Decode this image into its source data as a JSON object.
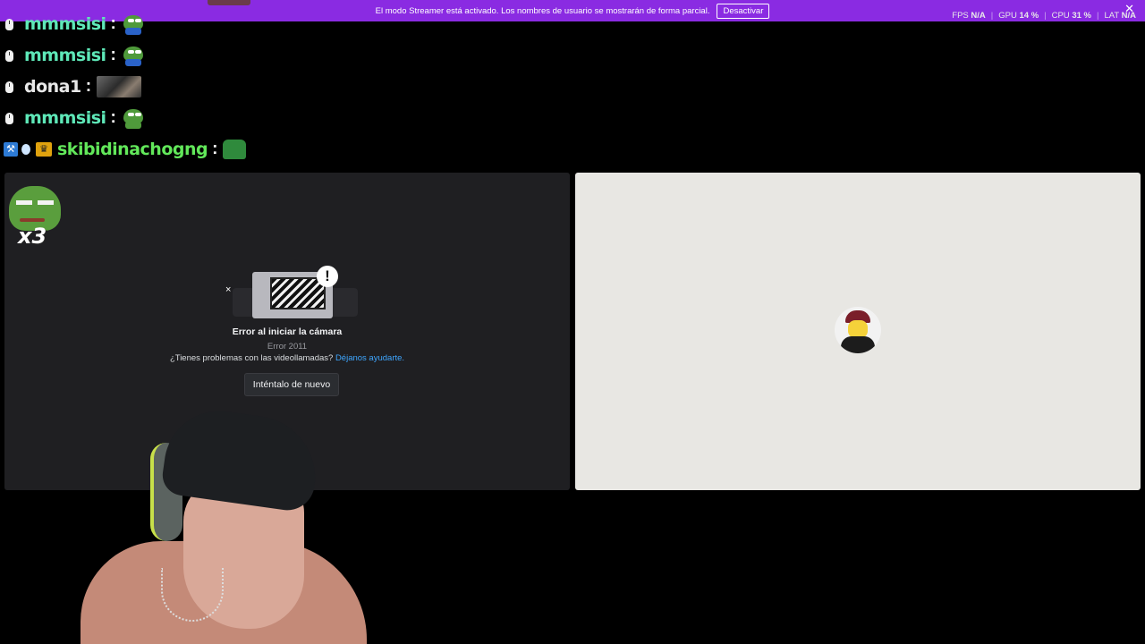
{
  "banner": {
    "message": "El modo Streamer está activado. Los nombres de usuario se mostrarán de forma parcial.",
    "button_label": "Desactivar",
    "close_glyph": "✕",
    "color": "#8a2be2"
  },
  "stats": {
    "fps_label": "FPS",
    "fps_value": "N/A",
    "gpu_label": "GPU",
    "gpu_value": "14 %",
    "cpu_label": "CPU",
    "cpu_value": "31 %",
    "lat_label": "LAT",
    "lat_value": "N/A"
  },
  "chat": [
    {
      "username": "mmmsisi",
      "color": "#5ee8b8",
      "emote": "pepe-icon"
    },
    {
      "username": "mmmsisi",
      "color": "#5ee8b8",
      "emote": "pepe-icon"
    },
    {
      "username": "dona1",
      "color": "#e8e8e8",
      "emote": "photo-emote"
    },
    {
      "username": "mmmsisi",
      "color": "#5ee8b8",
      "emote": "pepe-icon"
    },
    {
      "username": "skibidinachogng",
      "color": "#62e85a",
      "emote": "green-emote",
      "badges": [
        "hammer-badge-icon",
        "drop-badge-icon",
        "crown-badge-icon"
      ]
    }
  ],
  "chat_colon": ":",
  "overlay_emote": {
    "text": "x3",
    "icon": "pepe-sad-icon"
  },
  "camera_error": {
    "title": "Error al iniciar la cámara",
    "code": "Error 2011",
    "help_text": "¿Tienes problemas con las videollamadas?",
    "help_link": "Déjanos ayudarte.",
    "retry_label": "Inténtalo de nuevo",
    "alert_glyph": "!",
    "close_glyph": "×"
  },
  "participant": {
    "avatar": "avatar-icon"
  }
}
